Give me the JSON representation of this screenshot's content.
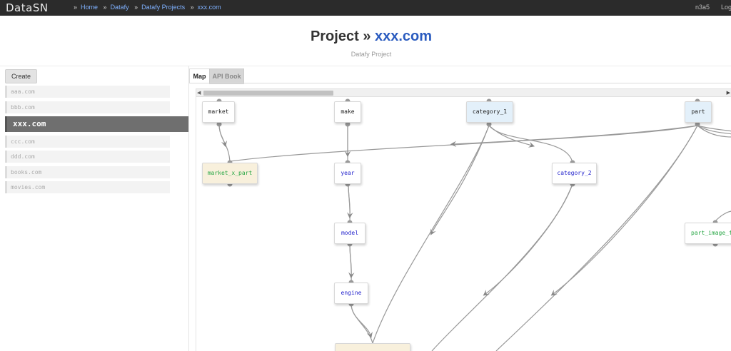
{
  "topbar": {
    "brand": "DataSN",
    "breadcrumbs": [
      "Home",
      "Datafy",
      "Datafy Projects",
      "xxx.com"
    ],
    "breadcrumb_sep": "»",
    "user": "n3a5",
    "logout": "Log"
  },
  "header": {
    "title_prefix": "Project",
    "title_sep": "»",
    "title_project": "xxx.com",
    "subtitle": "Datafy Project"
  },
  "sidebar": {
    "create_label": "Create",
    "projects": [
      {
        "label": "aaa.com",
        "active": false
      },
      {
        "label": "bbb.com",
        "active": false
      },
      {
        "label": "xxx.com",
        "active": true
      },
      {
        "label": "ccc.com",
        "active": false
      },
      {
        "label": "ddd.com",
        "active": false
      },
      {
        "label": "books.com",
        "active": false
      },
      {
        "label": "movies.com",
        "active": false
      }
    ]
  },
  "tabs": [
    {
      "label": "Map",
      "active": true
    },
    {
      "label": "API Book",
      "active": false
    }
  ],
  "map": {
    "nodes": {
      "market": "market",
      "make": "make",
      "category_1": "category_1",
      "part": "part",
      "market_x_part": "market_x_part",
      "year": "year",
      "category_2": "category_2",
      "model": "model",
      "part_image_fi": "part_image_fi",
      "engine": "engine"
    }
  }
}
